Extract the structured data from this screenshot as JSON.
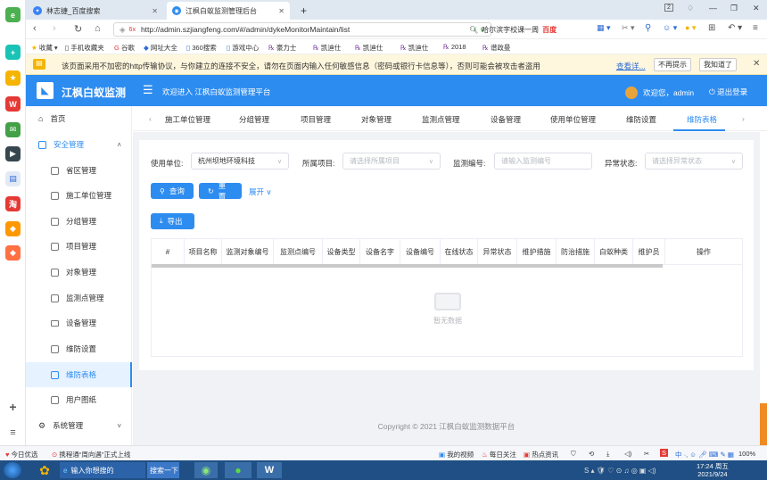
{
  "browser": {
    "tabs": [
      {
        "label": "林志捷_百度搜索",
        "icon": "paw-icon"
      },
      {
        "label": "江枫白蚁监测管理后台",
        "icon": "site-icon"
      }
    ],
    "tab_count": "2",
    "address": {
      "url": "http://admin.szjiangfeng.com/#/admin/dykeMonitorMaintain/list",
      "security_label": "6x"
    },
    "search": {
      "text": "哈尔滨字校课一周",
      "engine": "百度"
    },
    "bookmarks": [
      "收藏",
      "手机收藏夹",
      "谷歌",
      "网址大全",
      "360搜索",
      "游戏中心",
      "豪力士",
      "凯迪仕",
      "凯迪仕",
      "凯迪仕",
      "2018",
      "谱政曼"
    ]
  },
  "warning": {
    "text": "该页面采用不加密的http传输协议，与你建立的连接不安全，请勿在页面内输入任何敏感信息（密码或银行卡信息等），否则可能会被攻击者盗用",
    "link": "查看详...",
    "dismiss_label": "不再提示",
    "ok_label": "我知道了"
  },
  "app": {
    "title": "江枫白蚁监测",
    "welcome": "欢迎进入 江枫白蚁监测管理平台",
    "user_greeting": "欢迎您，admin",
    "logout": "退出登录",
    "colors": {
      "primary": "#2d8cf0",
      "header_bg": "#2d8cf0"
    }
  },
  "sidebar": {
    "home": "首页",
    "security": "安全管理",
    "items": [
      {
        "label": "省区管理"
      },
      {
        "label": "施工单位管理"
      },
      {
        "label": "分组管理"
      },
      {
        "label": "项目管理"
      },
      {
        "label": "对象管理"
      },
      {
        "label": "监测点管理"
      },
      {
        "label": "设备管理"
      },
      {
        "label": "维防设置"
      },
      {
        "label": "维防表格"
      },
      {
        "label": "用户图纸"
      }
    ],
    "system": "系统管理"
  },
  "page_tabs": [
    "施工单位管理",
    "分组管理",
    "项目管理",
    "对象管理",
    "监测点管理",
    "设备管理",
    "使用单位管理",
    "维防设置",
    "维防表格"
  ],
  "filters": {
    "unit_label": "使用单位:",
    "unit_value": "杭州坝地环境科技",
    "project_label": "所属项目:",
    "project_placeholder": "请选择所属项目",
    "code_label": "监测编号:",
    "code_placeholder": "请输入监测编号",
    "abnormal_label": "异常状态:",
    "abnormal_placeholder": "请选择异常状态"
  },
  "buttons": {
    "query": "查询",
    "reset": "重置",
    "expand": "展开",
    "export": "导出"
  },
  "table": {
    "columns": [
      "#",
      "项目名称",
      "监测对象编号",
      "监测点编号",
      "设备类型",
      "设备名字",
      "设备编号",
      "在线状态",
      "异常状态",
      "维护措施",
      "防治措施",
      "白蚁种类",
      "维护员",
      "操作"
    ],
    "empty_text": "暂无数据"
  },
  "footer": "Copyright © 2021 江枫白蚁监测数据平台",
  "statusbar": {
    "left": "今日优选",
    "news": "携程通“周向遇”正式上线",
    "items": [
      "我的视频",
      "每日关注",
      "热点资讯"
    ],
    "zoom": "100%"
  },
  "taskbar": {
    "ie_item": "输入你想搜的",
    "search_btn": "搜索一下",
    "time": "17:24 周五",
    "date": "2021/9/24"
  }
}
